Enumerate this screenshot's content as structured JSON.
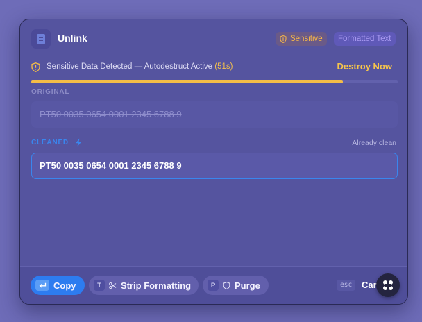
{
  "app": {
    "title": "Unlink",
    "icon": "document-icon"
  },
  "badges": {
    "sensitive": "Sensitive",
    "formatted": "Formatted Text"
  },
  "alert": {
    "message": "Sensitive Data Detected — Autodestruct Active",
    "countdown": "(51s)",
    "action": "Destroy Now",
    "progress": 0.85
  },
  "original": {
    "label": "ORIGINAL",
    "value": "PT50 0035 0654 0001 2345 6788 9"
  },
  "cleaned": {
    "label": "CLEANED",
    "status": "Already clean",
    "value": "PT50 0035 0654 0001 2345 6788 9"
  },
  "footer": {
    "copy_label": "Copy",
    "strip_key": "T",
    "strip_label": "Strip Formatting",
    "purge_key": "P",
    "purge_label": "Purge",
    "esc_key": "esc",
    "cancel_label": "Cancel"
  },
  "colors": {
    "accent_blue": "#2d7cf0",
    "warning": "#f4bd47",
    "panel": "#55549f"
  }
}
